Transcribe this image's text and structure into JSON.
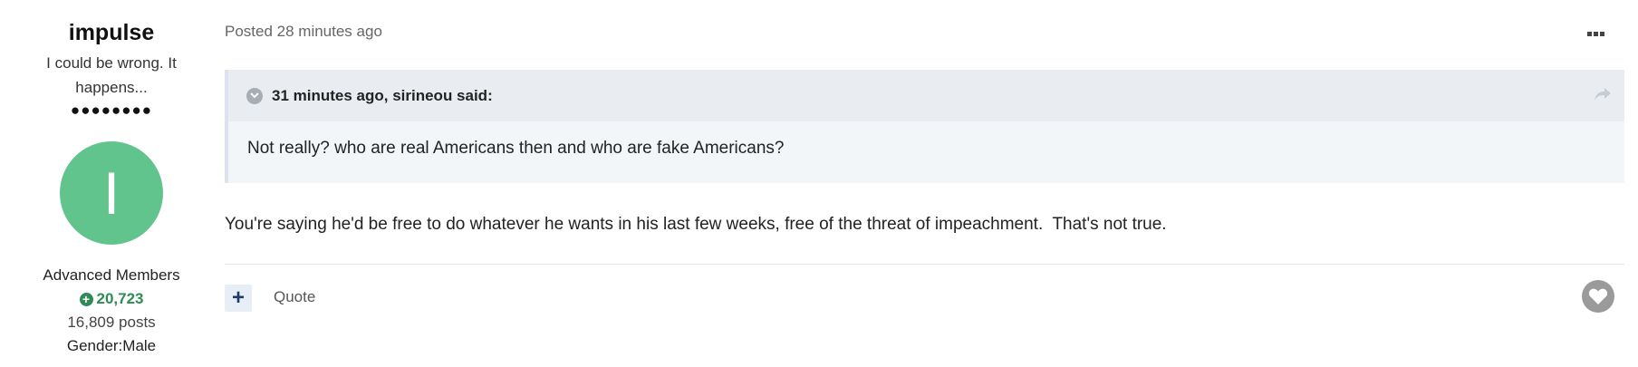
{
  "author": {
    "name": "impulse",
    "title": "I could be wrong. It happens...",
    "rank_dots": "●●●●●●●●",
    "avatar_letter": "I",
    "avatar_color": "#62c48d",
    "group": "Advanced Members",
    "reputation": "20,723",
    "post_count": "16,809 posts",
    "gender": "Gender:Male"
  },
  "post": {
    "posted_meta": "Posted 28 minutes ago",
    "more_icon": "ellipsis-icon",
    "quote": {
      "citation": "31 minutes ago, sirineou said:",
      "text": "Not really? who are real Americans then and who are fake Americans?",
      "toggle_icon": "chevron-down-icon",
      "share_icon": "share-arrow-icon"
    },
    "body": "You're saying he'd be free to do whatever he wants in his last few weeks, free of the threat of impeachment.  That's not true."
  },
  "actions": {
    "multiquote_symbol": "+",
    "quote_label": "Quote",
    "like_icon": "heart-icon"
  },
  "colors": {
    "reputation": "#2e8b57",
    "quote_background": "#f3f6f9",
    "quote_header_background": "#e9edf1",
    "like_button": "#9a9a9a"
  }
}
